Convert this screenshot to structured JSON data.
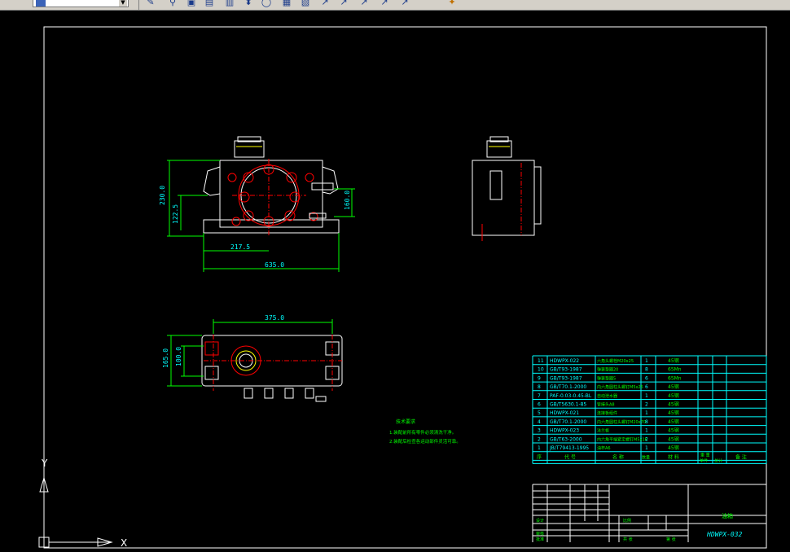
{
  "toolbar": {
    "layer_combo_value": "",
    "icons": [
      "layer-icon",
      "chevron-down-icon",
      "paint-icon",
      "link-icon",
      "zoom-window-icon",
      "align-icon",
      "measure-icon",
      "pan-icon",
      "orbit-icon",
      "print-icon",
      "arrow-icon",
      "wand-icon"
    ]
  },
  "drawing": {
    "front_view_dims": {
      "h_total": "230.0",
      "h_mid": "122.5",
      "w_half": "217.5",
      "w_total": "635.0",
      "side_bolt": "160.0"
    },
    "top_view_dims": {
      "w": "375.0",
      "h_outer": "165.0",
      "h_inner": "100.0"
    },
    "notes_title": "技术要求",
    "notes": [
      "1.装配前所有零件必须清洗干净。",
      "2.装配后检查各运动部件灵活可靠。"
    ],
    "bom": [
      {
        "no": "11",
        "code": "HDWPX-022",
        "name": "六角头螺栓M20x25",
        "qty": "1",
        "mat": "45钢"
      },
      {
        "no": "10",
        "code": "GB/T93-1987",
        "name": "弹簧垫圈20",
        "qty": "8",
        "mat": "65Mn"
      },
      {
        "no": "9",
        "code": "GB/T93-1987",
        "name": "弹簧垫圈5",
        "qty": "6",
        "mat": "65Mn"
      },
      {
        "no": "8",
        "code": "GB/T70.1-2000",
        "name": "内六角圆柱头螺钉M5x25",
        "qty": "6",
        "mat": "45钢"
      },
      {
        "no": "7",
        "code": "PAF-0.03-0.45-BL",
        "name": "自动泄水器",
        "qty": "1",
        "mat": "45钢"
      },
      {
        "no": "6",
        "code": "GB/T5630.1-85",
        "name": "管接头A8",
        "qty": "2",
        "mat": "45钢"
      },
      {
        "no": "5",
        "code": "HDWPX-021",
        "name": "连接板组件",
        "qty": "1",
        "mat": "45钢"
      },
      {
        "no": "4",
        "code": "GB/T70.1-2000",
        "name": "内六角圆柱头螺钉M20x70",
        "qty": "8",
        "mat": "45钢"
      },
      {
        "no": "3",
        "code": "HDWPX-023",
        "name": "法兰板",
        "qty": "1",
        "mat": "45钢"
      },
      {
        "no": "2",
        "code": "GB/T63-2000",
        "name": "内六角平端紧定螺钉M5x16",
        "qty": "2",
        "mat": "45钢"
      },
      {
        "no": "1",
        "code": "JB/T79413-1995",
        "name": "油杯A6",
        "qty": "1",
        "mat": "45钢"
      }
    ],
    "bom_header": {
      "no": "序",
      "code": "代 号",
      "name": "名 称",
      "qty": "数量",
      "mat": "材 料",
      "wt1": "单件",
      "wt2": "总计",
      "note": "备 注",
      "wt_head": "重 量"
    },
    "title_block": {
      "name": "油箱",
      "drawing_no": "HDWPX-032",
      "scale_label": "比例",
      "sheet_label": "共 张",
      "page_label": "第 张",
      "designer": "设计",
      "checker": "审核",
      "approve": "批准"
    },
    "ucs": {
      "x": "X",
      "y": "Y"
    }
  },
  "colors": {
    "frame": "#ffffff",
    "cyan": "#00ffff",
    "red": "#ff0000",
    "green": "#00ff00",
    "yellow": "#ffff00",
    "white": "#ffffff"
  }
}
